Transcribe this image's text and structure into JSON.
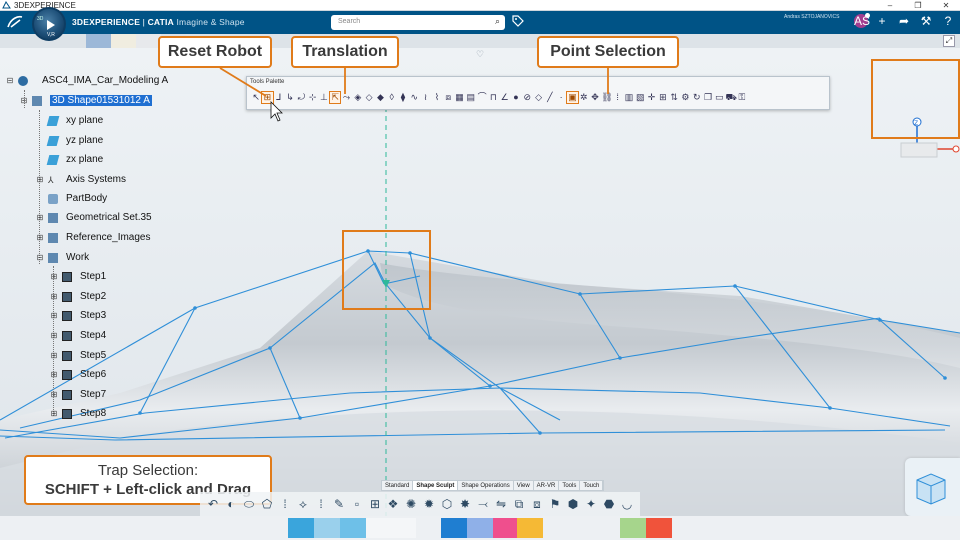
{
  "window": {
    "title": "3DEXPERIENCE",
    "controls": [
      "–",
      "❐",
      "✕"
    ]
  },
  "header": {
    "compass_top": "3D",
    "compass_bottom": "V,R",
    "brand_bold": "3DEXPERIENCE",
    "brand_sep": " | ",
    "brand_app": "CATIA",
    "brand_sub": " Imagine & Shape",
    "search_placeholder": "Search",
    "user_name": "Andras SZTOJANOVICS",
    "avatar_text": "AS",
    "icons": [
      "plus-icon",
      "share-icon",
      "tools-icon",
      "help-icon"
    ]
  },
  "tree": {
    "root": "ASC4_IMA_Car_Modeling A",
    "shape": "3D Shape01531012 A",
    "items": [
      {
        "label": "xy plane",
        "icon": "plane-icon"
      },
      {
        "label": "yz plane",
        "icon": "plane-icon"
      },
      {
        "label": "zx plane",
        "icon": "plane-icon"
      },
      {
        "label": "Axis Systems",
        "icon": "axis-icon"
      },
      {
        "label": "PartBody",
        "icon": "body-icon"
      },
      {
        "label": "Geometrical Set.35",
        "icon": "geoset-icon"
      },
      {
        "label": "Reference_Images",
        "icon": "geoset-icon"
      },
      {
        "label": "Work",
        "icon": "geoset-icon"
      }
    ],
    "steps": [
      "Step1",
      "Step2",
      "Step3",
      "Step4",
      "Step5",
      "Step6",
      "Step7",
      "Step8"
    ]
  },
  "palette": {
    "title": "Tools Palette"
  },
  "callouts": {
    "reset_robot": "Reset Robot",
    "translation": "Translation",
    "point_selection": "Point Selection",
    "trap_line1": "Trap Selection:",
    "trap_line2": "SCHIFT + Left-click and Drag"
  },
  "triad": {
    "axis_label": "Z"
  },
  "action_tabs": [
    {
      "label": "Standard",
      "active": false
    },
    {
      "label": "Shape Sculpt",
      "active": true
    },
    {
      "label": "Shape Operations",
      "active": false
    },
    {
      "label": "View",
      "active": false
    },
    {
      "label": "AR-VR",
      "active": false
    },
    {
      "label": "Tools",
      "active": false
    },
    {
      "label": "Touch",
      "active": false
    }
  ],
  "colors": {
    "header_bg": "#005386",
    "accent_orange": "#e07b1a",
    "selection_blue": "#1f6fd1",
    "mesh_blue": "#2f8fd8",
    "taskbar_chips": [
      "#3aa5dc",
      "#9ad0ec",
      "#6ec0e8",
      "#cfe6f5",
      "#f4f6f8",
      "#1f7ed1",
      "#8fb0e8",
      "#ef4f8d",
      "#f5b935",
      "#a6d58c",
      "#f0533b"
    ]
  }
}
